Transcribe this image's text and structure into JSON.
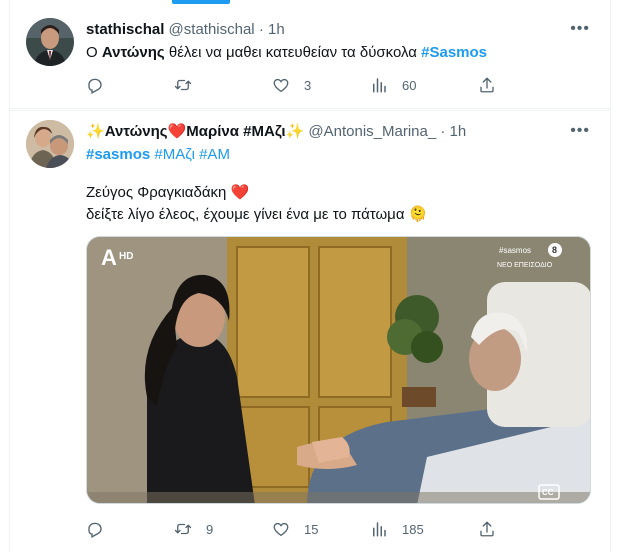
{
  "tweets": [
    {
      "display_name": "stathischal",
      "handle": "@stathischal",
      "separator": "·",
      "time": "1h",
      "text_prefix": "Ο ",
      "text_bold": "Αντώνης",
      "text_mid": " θέλει να μαθει κατευθείαν τα δύσκολα ",
      "hashtag": "#Sasmos",
      "stats": {
        "replies": "",
        "retweets": "",
        "likes": "3",
        "views": "60"
      }
    },
    {
      "name_emoji_left": "✨",
      "display_name": "Αντώνης",
      "heart": "❤️",
      "display_name_2": "Μαρίνα #ΜΑζι",
      "name_emoji_right": "✨",
      "handle": "@Antonis_Marina_",
      "separator": "·",
      "time": "1h",
      "hashtag_1": "#sasmos",
      "hashtag_2": "#ΜΑζι",
      "hashtag_3": "#AM",
      "line_1": "Ζεύγος Φραγκιαδάκη",
      "line_1_emoji": "❤️",
      "line_2": "δείξτε λίγο έλεος, έχουμε γίνει ένα με το πάτωμα",
      "line_2_emoji": "🫠",
      "media": {
        "channel_logo": "A",
        "hd": "HD",
        "overlay_tag": "#sasmos",
        "age_rating": "8",
        "overlay_subtitle": "ΝΕΟ ΕΠΕΙΣΟΔΙΟ",
        "cc": "CC"
      },
      "stats": {
        "replies": "",
        "retweets": "9",
        "likes": "15",
        "views": "185"
      }
    }
  ],
  "icons": {
    "more": "more-horizontal-icon",
    "reply": "reply-icon",
    "retweet": "retweet-icon",
    "like": "heart-icon",
    "views": "views-chart-icon",
    "share": "share-icon"
  },
  "colors": {
    "link": "#1d9bf0",
    "muted": "#536471",
    "text": "#0f1419",
    "heart": "#e0245e"
  }
}
